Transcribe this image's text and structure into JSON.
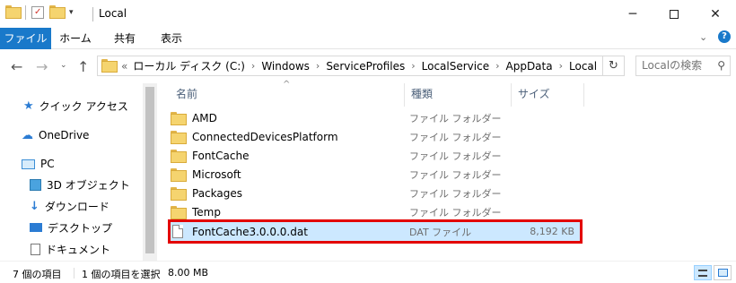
{
  "window": {
    "title": "Local",
    "min_icon": "minimize-icon",
    "max_icon": "maximize-icon",
    "close_icon": "close-icon"
  },
  "ribbon": {
    "tabs": [
      "ファイル",
      "ホーム",
      "共有",
      "表示"
    ]
  },
  "address": {
    "overflow": "«",
    "crumbs": [
      "ローカル ディスク (C:)",
      "Windows",
      "ServiceProfiles",
      "LocalService",
      "AppData",
      "Local"
    ],
    "search_placeholder": "Localの検索"
  },
  "nav": {
    "quick_access": "クイック アクセス",
    "onedrive": "OneDrive",
    "pc": "PC",
    "objects3d": "3D オブジェクト",
    "downloads": "ダウンロード",
    "desktop": "デスクトップ",
    "documents": "ドキュメント"
  },
  "columns": {
    "name": "名前",
    "type": "種類",
    "size": "サイズ"
  },
  "files": [
    {
      "name": "AMD",
      "type": "ファイル フォルダー",
      "size": ""
    },
    {
      "name": "ConnectedDevicesPlatform",
      "type": "ファイル フォルダー",
      "size": ""
    },
    {
      "name": "FontCache",
      "type": "ファイル フォルダー",
      "size": ""
    },
    {
      "name": "Microsoft",
      "type": "ファイル フォルダー",
      "size": ""
    },
    {
      "name": "Packages",
      "type": "ファイル フォルダー",
      "size": ""
    },
    {
      "name": "Temp",
      "type": "ファイル フォルダー",
      "size": ""
    },
    {
      "name": "FontCache3.0.0.0.dat",
      "type": "DAT ファイル",
      "size": "8,192 KB"
    }
  ],
  "status": {
    "item_count": "7 個の項目",
    "selected": "1 個の項目を選択",
    "selected_size": "8.00 MB"
  },
  "colors": {
    "accent": "#1979ca",
    "selection": "#cce8ff",
    "highlight_box": "#e30000"
  }
}
